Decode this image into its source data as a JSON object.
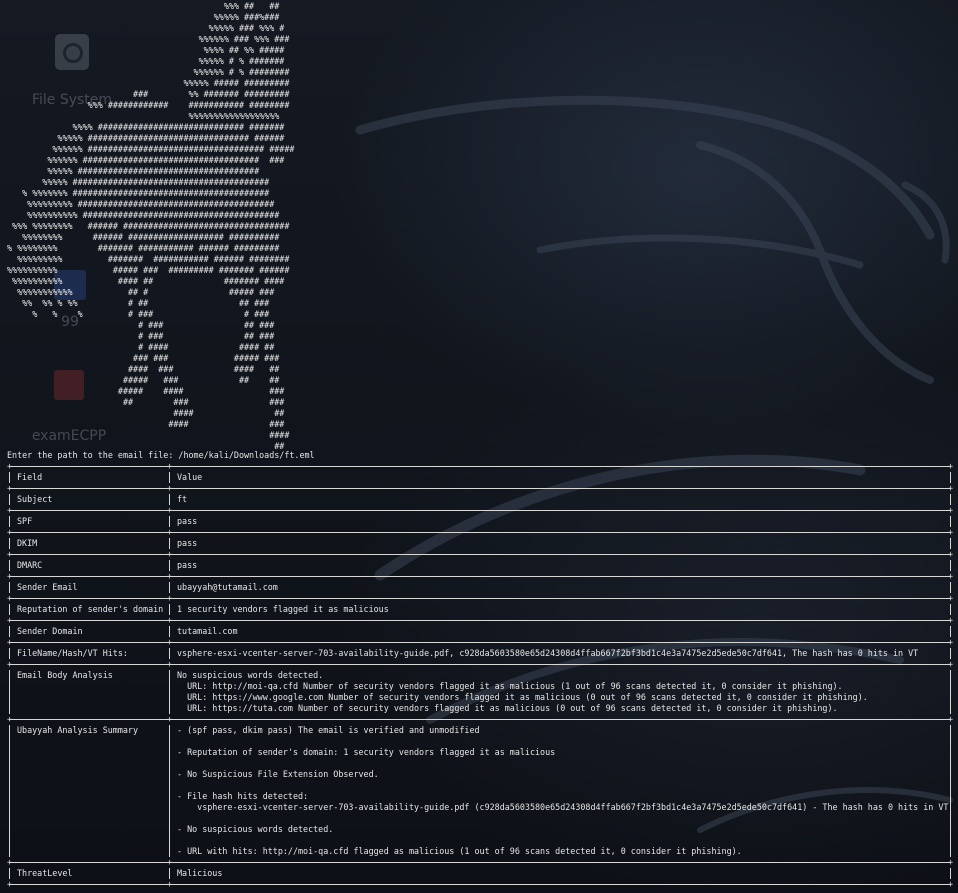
{
  "desktop": {
    "icons": [
      {
        "label": "File System"
      },
      {
        "label": "99"
      },
      {
        "label": "examECPP"
      }
    ]
  },
  "terminal": {
    "ascii_art": "                                           %%% ##   ##\n                                         %%%%% ###%###\n                                        %%%%% ### %%% #\n                                      %%%%%% ### %%% ###\n                                       %%%% ## %% #####\n                                      %%%%% # % #######\n                                     %%%%%% # % ########\n                                   %%%%% ##### #########\n                         ###        %% ####### #########\n                %%% ############    ########### ########\n                                    %%%%%%%%%%%%%%%%%%\n             %%%% ############################# #######\n          %%%%% ################################ ######\n         %%%%%% ################################### #####\n        %%%%%% ###################################  ###\n        %%%%% ####################################\n       %%%%% #######################################\n   % %%%%%%% #######################################\n    %%%%%%%%% #######################################\n    %%%%%%%%%% #######################################\n %%% %%%%%%%%   ###### #################################\n   %%%%%%%%      ###### ################### ##########\n% %%%%%%%%        ####### ########### ###### #########\n  %%%%%%%%%         #######  ########### ###### ########\n%%%%%%%%%%           ##### ###  ######### ####### ######\n %%%%%%%%%%           #### ##              ####### ####\n  %%%%%%%%%%%           ## #                ##### ###\n   %%  %% % %%          # ##                  ## ###\n     %   %    %         # ###                  # ###\n                          # ###                ## ###\n                          # ###                ## ###\n                          # ####              #### ##\n                         ### ###             ##### ###\n                        ####  ###            ####   ##\n                       #####   ###            ##    ##\n                      #####    ####                 ###\n                       ##        ###                ###\n                                 ####                ##\n                                ####                ###\n                                                    ####\n                                                     ##",
    "prompt": "Enter the path to the email file: /home/kali/Downloads/ft.eml",
    "table": {
      "header": {
        "field": "Field",
        "value": "Value"
      },
      "rows": [
        {
          "field": "Subject",
          "value": [
            "ft"
          ]
        },
        {
          "field": "SPF",
          "value": [
            "pass"
          ]
        },
        {
          "field": "DKIM",
          "value": [
            "pass"
          ]
        },
        {
          "field": "DMARC",
          "value": [
            "pass"
          ]
        },
        {
          "field": "Sender Email",
          "value": [
            "ubayyah@tutamail.com"
          ]
        },
        {
          "field": "Reputation of sender's domain",
          "value": [
            "1 security vendors flagged it as malicious"
          ]
        },
        {
          "field": "Sender Domain",
          "value": [
            "tutamail.com"
          ]
        },
        {
          "field": "FileName/Hash/VT Hits:",
          "value": [
            "vsphere-esxi-vcenter-server-703-availability-guide.pdf, c928da5603580e65d24308d4ffab667f2bf3bd1c4e3a7475e2d5ede50c7df641, The hash has 0 hits in VT"
          ]
        },
        {
          "field": "Email Body Analysis",
          "value": [
            "No suspicious words detected.",
            "  URL: http://moi-qa.cfd Number of security vendors flagged it as malicious (1 out of 96 scans detected it, 0 consider it phishing).",
            "  URL: https://www.google.com Number of security vendors flagged it as malicious (0 out of 96 scans detected it, 0 consider it phishing).",
            "  URL: https://tuta.com Number of security vendors flagged it as malicious (0 out of 96 scans detected it, 0 consider it phishing)."
          ]
        },
        {
          "field": "Ubayyah Analysis Summary",
          "value": [
            "- (spf pass, dkim pass) The email is verified and unmodified",
            "",
            "- Reputation of sender's domain: 1 security vendors flagged it as malicious",
            "",
            "- No Suspicious File Extension Observed.",
            "",
            "- File hash hits detected:",
            "    vsphere-esxi-vcenter-server-703-availability-guide.pdf (c928da5603580e65d24308d4ffab667f2bf3bd1c4e3a7475e2d5ede50c7df641) - The hash has 0 hits in VT",
            "",
            "- No suspicious words detected.",
            "",
            "- URL with hits: http://moi-qa.cfd flagged as malicious (1 out of 96 scans detected it, 0 consider it phishing)."
          ]
        },
        {
          "field": "ThreatLevel",
          "value": [
            "Malicious"
          ]
        }
      ]
    }
  }
}
